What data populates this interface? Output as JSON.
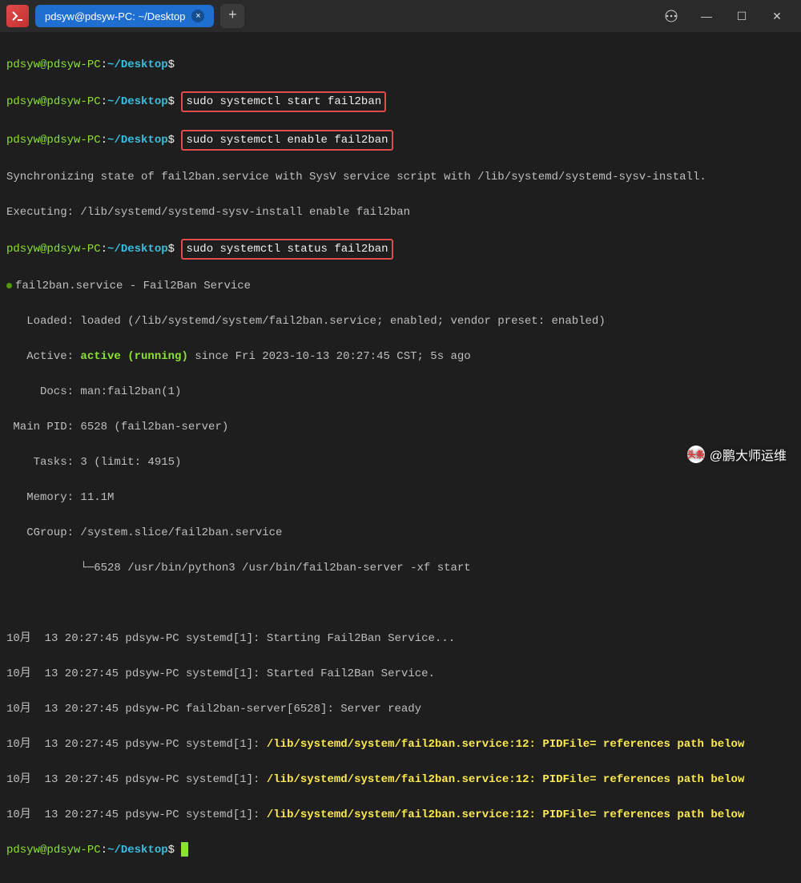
{
  "titlebar": {
    "tab_title": "pdsyw@pdsyw-PC: ~/Desktop",
    "tab_close": "×",
    "new_tab": "+",
    "menu_icon": "⋯",
    "minimize": "—",
    "maximize": "☐",
    "close": "✕"
  },
  "prompt": {
    "user": "pdsyw",
    "at": "@",
    "host": "pdsyw-PC",
    "colon": ":",
    "path": "~/Desktop",
    "dollar": "$"
  },
  "cmd1": "sudo systemctl start fail2ban",
  "cmd2": "sudo systemctl enable fail2ban",
  "out_sync": "Synchronizing state of fail2ban.service with SysV service script with /lib/systemd/systemd-sysv-install.",
  "out_exec": "Executing: /lib/systemd/systemd-sysv-install enable fail2ban",
  "cmd3": "sudo systemctl status fail2ban",
  "status": {
    "header": "fail2ban.service - Fail2Ban Service",
    "loaded": "   Loaded: loaded (/lib/systemd/system/fail2ban.service; enabled; vendor preset: enabled)",
    "active_label": "   Active: ",
    "active_state": "active (running)",
    "active_since": " since Fri 2023-10-13 20:27:45 CST; 5s ago",
    "docs": "     Docs: man:fail2ban(1)",
    "mainpid": " Main PID: 6528 (fail2ban-server)",
    "tasks": "    Tasks: 3 (limit: 4915)",
    "memory": "   Memory: 11.1M",
    "cgroup": "   CGroup: /system.slice/fail2ban.service",
    "cgroup_proc": "           └─6528 /usr/bin/python3 /usr/bin/fail2ban-server -xf start"
  },
  "logs": {
    "l1_prefix": "10月  13 20:27:45 pdsyw-PC systemd[1]: ",
    "l1_msg": "Starting Fail2Ban Service...",
    "l2_prefix": "10月  13 20:27:45 pdsyw-PC systemd[1]: ",
    "l2_msg": "Started Fail2Ban Service.",
    "l3": "10月  13 20:27:45 pdsyw-PC fail2ban-server[6528]: Server ready",
    "l4_prefix": "10月  13 20:27:45 pdsyw-PC systemd[1]: ",
    "l4_msg": "/lib/systemd/system/fail2ban.service:12: PIDFile= references path below",
    "l5_prefix": "10月  13 20:27:45 pdsyw-PC systemd[1]: ",
    "l5_msg": "/lib/systemd/system/fail2ban.service:12: PIDFile= references path below",
    "l6_prefix": "10月  13 20:27:45 pdsyw-PC systemd[1]: ",
    "l6_msg": "/lib/systemd/system/fail2ban.service:12: PIDFile= references path below"
  },
  "watermark": {
    "brand": "头条",
    "text": "@鹏大师运维"
  }
}
